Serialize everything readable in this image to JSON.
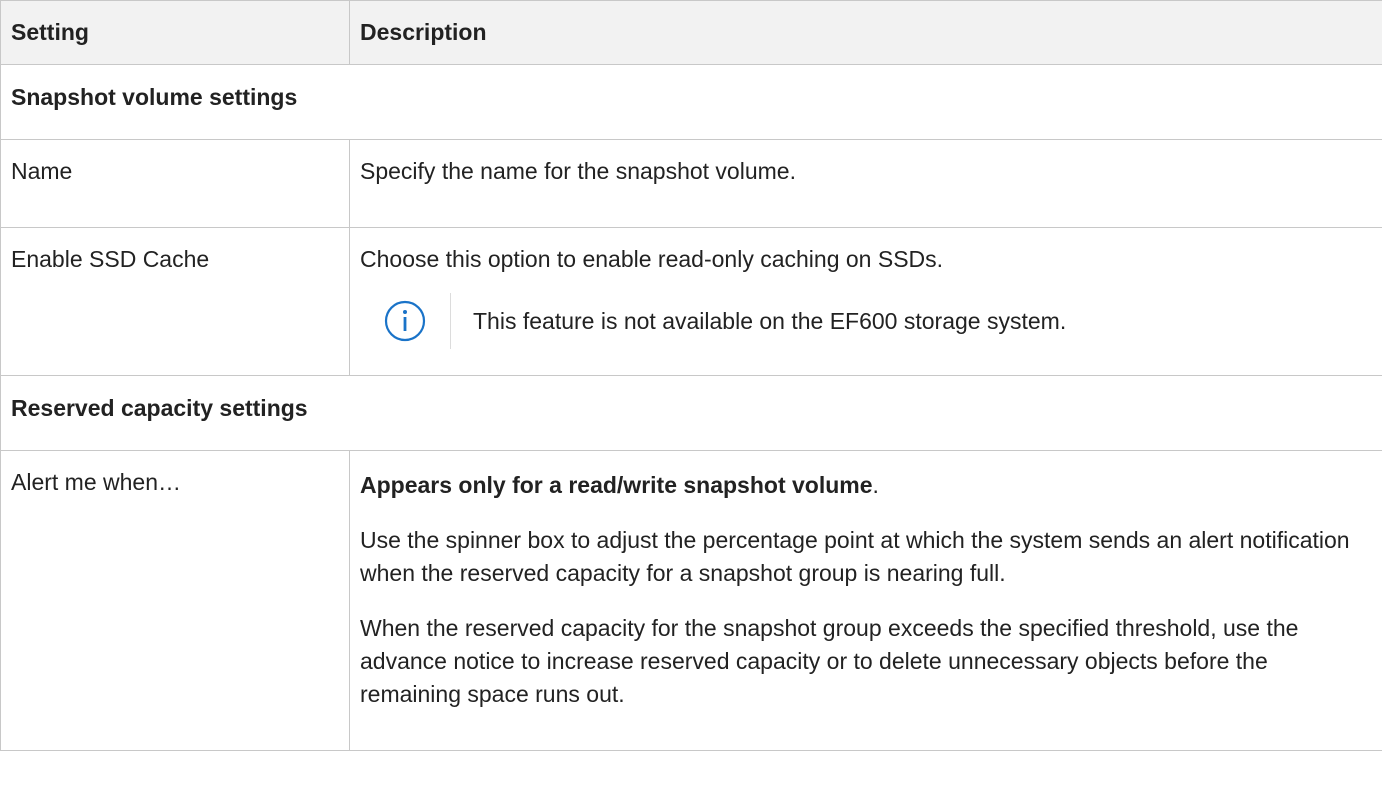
{
  "table": {
    "headers": [
      "Setting",
      "Description"
    ],
    "sections": {
      "snapshot": "Snapshot volume settings",
      "reserved": "Reserved capacity settings"
    },
    "rows": {
      "name": {
        "setting": "Name",
        "description": "Specify the name for the snapshot volume."
      },
      "ssd": {
        "setting": "Enable SSD Cache",
        "description": "Choose this option to enable read-only caching on SSDs.",
        "note": "This feature is not available on the EF600 storage system.",
        "note_icon": "info-icon"
      },
      "alert": {
        "setting": "Alert me when…",
        "bold_lead": "Appears only for a read/write snapshot volume",
        "bold_lead_suffix": ".",
        "para1": "Use the spinner box to adjust the percentage point at which the system sends an alert notification when the reserved capacity for a snapshot group is nearing full.",
        "para2": "When the reserved capacity for the snapshot group exceeds the specified threshold, use the advance notice to increase reserved capacity or to delete unnecessary objects before the remaining space runs out."
      }
    }
  },
  "colors": {
    "header_bg": "#f2f2f2",
    "border": "#c8c8c8",
    "info_icon": "#1a73c8"
  }
}
